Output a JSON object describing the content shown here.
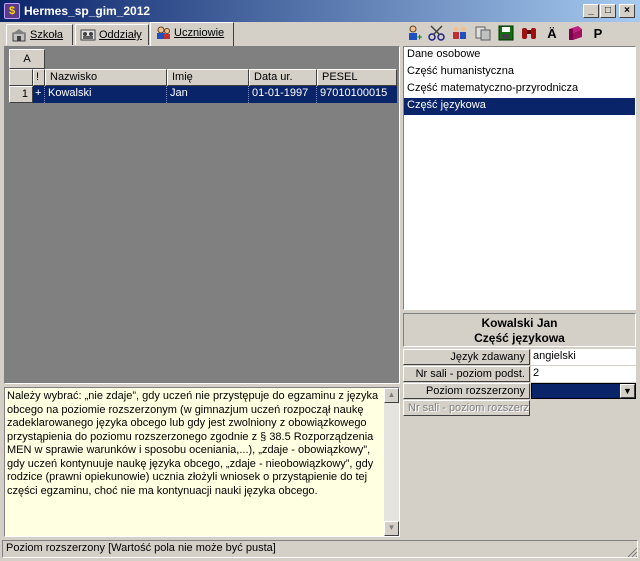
{
  "window": {
    "title": "Hermes_sp_gim_2012",
    "minimize": "_",
    "maximize": "□",
    "close": "×"
  },
  "tabs": [
    {
      "label": "Szkoła",
      "icon": "school-icon"
    },
    {
      "label": "Oddziały",
      "icon": "classes-icon"
    },
    {
      "label": "Uczniowie",
      "icon": "students-icon"
    }
  ],
  "toolbar": {
    "icons": [
      "add-student-icon",
      "cut-icon",
      "group-icon",
      "move-icon",
      "save-icon",
      "binoculars-icon",
      "umlaut-icon",
      "book-icon",
      "p-icon"
    ],
    "umlaut_label": "Ä",
    "p_label": "P"
  },
  "grid": {
    "filter_label": "A",
    "columns": [
      "",
      "!",
      "Nazwisko",
      "Imię",
      "Data ur.",
      "PESEL"
    ],
    "rows": [
      {
        "num": "1",
        "flag": "+",
        "surname": "Kowalski",
        "name": "Jan",
        "birth": "01-01-1997",
        "pesel": "97010100015"
      }
    ]
  },
  "sections": {
    "items": [
      "Dane osobowe",
      "Część humanistyczna",
      "Część matematyczno-przyrodnicza",
      "Część językowa"
    ],
    "selected_index": 3
  },
  "info": {
    "student_name": "Kowalski Jan",
    "section_title": "Część językowa"
  },
  "form": {
    "language_label": "Język zdawany",
    "language_value": "angielski",
    "room_basic_label": "Nr sali - poziom podst.",
    "room_basic_value": "2",
    "extended_level_label": "Poziom rozszerzony",
    "extended_level_value": "",
    "room_extended_label": "Nr sali - poziom rozszerz."
  },
  "help": {
    "text": "Należy wybrać: „nie zdaje”, gdy uczeń nie przystępuje do egzaminu z języka obcego na poziomie rozszerzonym (w gimnazjum uczeń rozpoczął naukę zadeklarowanego języka obcego lub gdy jest zwolniony z obowiązkowego przystąpienia do poziomu rozszerzonego zgodnie z § 38.5 Rozporządzenia MEN w sprawie warunków i sposobu oceniania,...), „zdaje - obowiązkowy”, gdy uczeń kontynuuje naukę języka obcego, „zdaje - nieobowiązkowy”, gdy rodzice (prawni opiekunowie) ucznia złożyli wniosek o przystąpienie do tej części egzaminu, choć nie ma kontynuacji nauki języka obcego."
  },
  "status": {
    "text": "Poziom rozszerzony [Wartość pola nie może być pusta]"
  },
  "colors": {
    "selection": "#0a246a",
    "help_bg": "#ffffe1",
    "face": "#d4d0c8"
  }
}
